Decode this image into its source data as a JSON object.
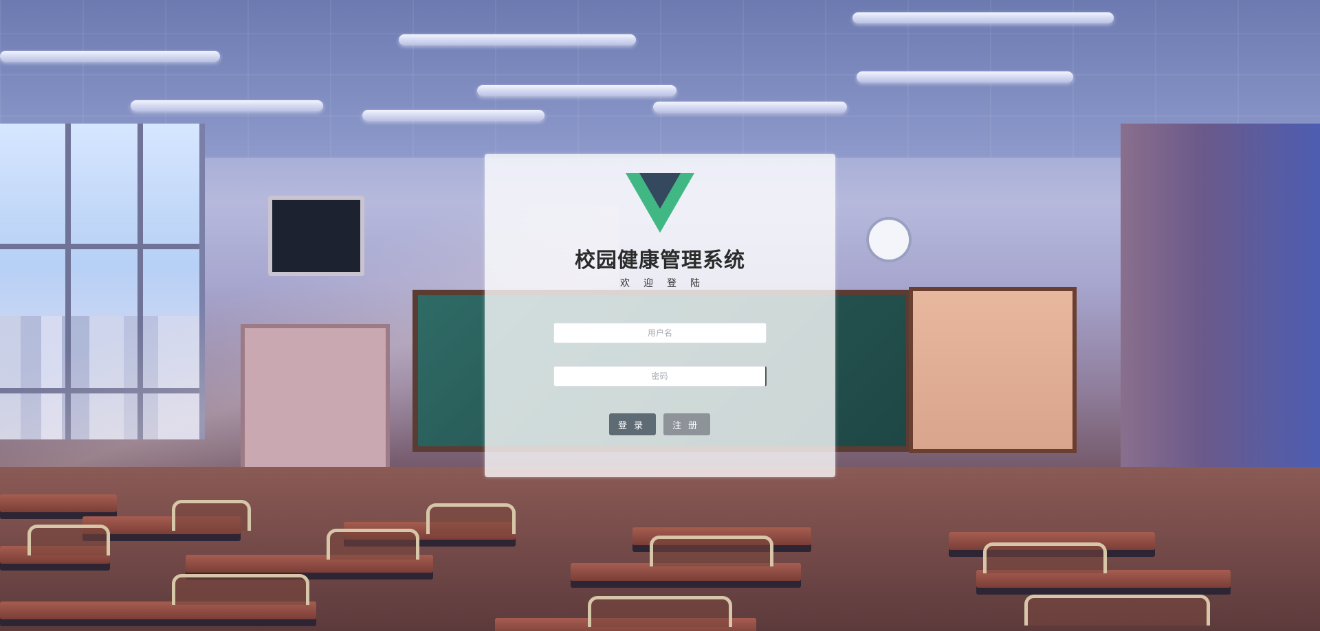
{
  "login": {
    "logo": "vue-logo-icon",
    "title": "校园健康管理系统",
    "subtitle": "欢迎登陆",
    "username_placeholder": "用户名",
    "password_placeholder": "密码",
    "login_button": "登录",
    "register_button": "注册"
  },
  "colors": {
    "logo_outer": "#41b883",
    "logo_inner": "#35495e",
    "login_button": "#5f6b74",
    "register_button": "#8d9398"
  }
}
